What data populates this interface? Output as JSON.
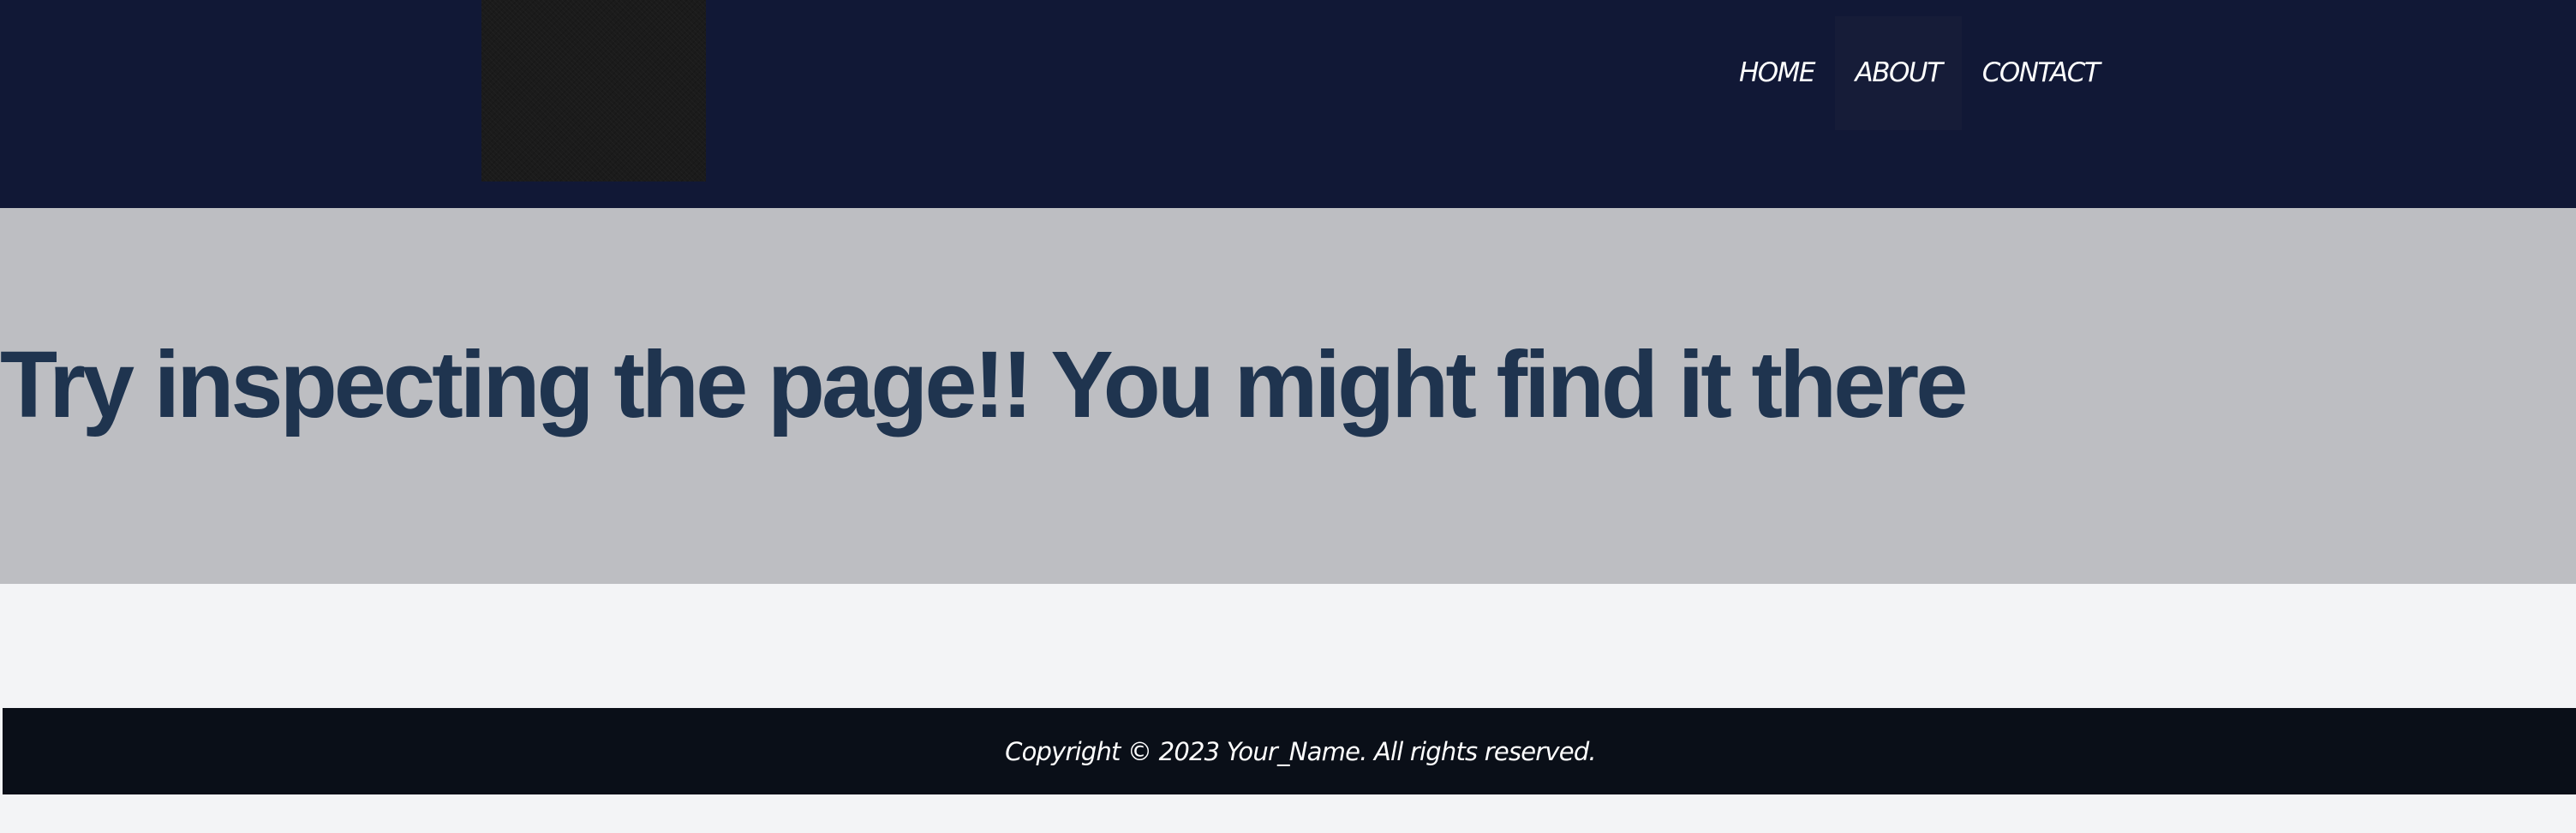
{
  "nav": {
    "items": [
      {
        "label": "HOME"
      },
      {
        "label": "ABOUT"
      },
      {
        "label": "CONTACT"
      }
    ]
  },
  "hero": {
    "title": "Try inspecting the page!! You might find it there"
  },
  "footer": {
    "copyright": "Copyright © 2023 Your_Name. All rights reserved."
  },
  "colors": {
    "navbar": "#111836",
    "hero": "#bdbec2",
    "title": "#1f344f",
    "footer": "#0a0f18",
    "page": "#f3f4f6"
  }
}
